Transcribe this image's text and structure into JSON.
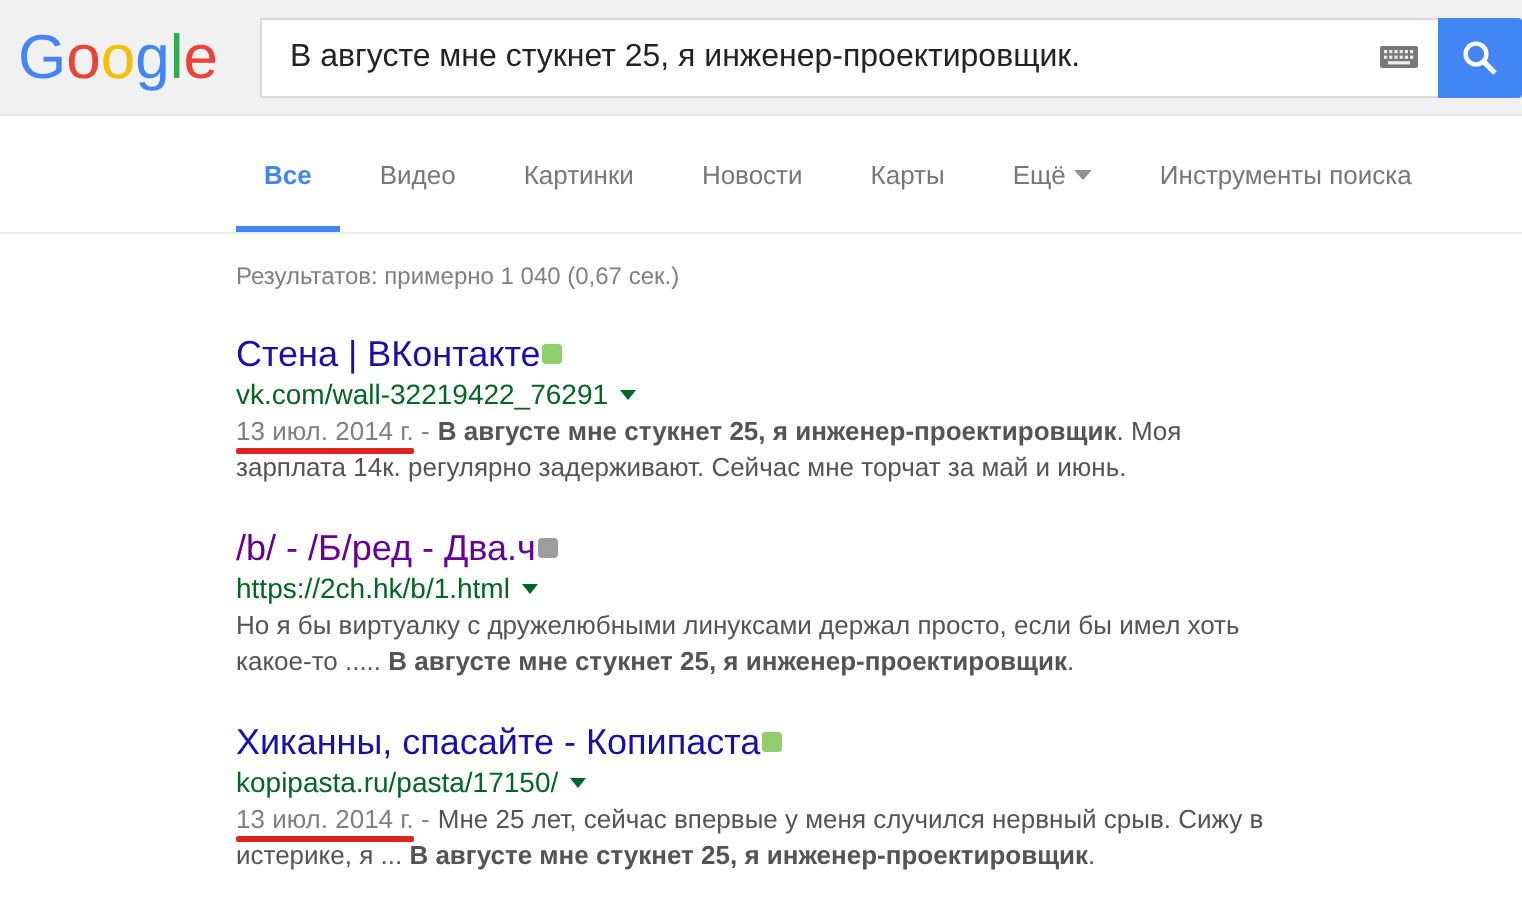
{
  "logo": "Google",
  "search": {
    "value": "В августе мне стукнет 25, я инженер-проектировщик."
  },
  "tabs": [
    {
      "label": "Все",
      "selected": true,
      "kind": "tab"
    },
    {
      "label": "Видео",
      "selected": false,
      "kind": "tab"
    },
    {
      "label": "Картинки",
      "selected": false,
      "kind": "tab"
    },
    {
      "label": "Новости",
      "selected": false,
      "kind": "tab"
    },
    {
      "label": "Карты",
      "selected": false,
      "kind": "tab"
    },
    {
      "label": "Ещё",
      "selected": false,
      "kind": "menu"
    },
    {
      "label": "Инструменты поиска",
      "selected": false,
      "kind": "tool"
    }
  ],
  "result_stats": "Результатов: примерно 1 040 (0,67 сек.)",
  "results": [
    {
      "title": "Стена | ВКонтакте",
      "visited": false,
      "color": "#8fce6b",
      "url": "vk.com/wall-32219422_76291",
      "date": "13 июл. 2014 г. -",
      "underlined": true,
      "snippet": "**В августе мне стукнет 25, я инженер-проектировщик**. Моя зарплата 14к. регулярно задерживают. Сейчас мне торчат за май и июнь."
    },
    {
      "title": "/b/ - /Б/ред - Два.ч",
      "visited": true,
      "color": "#9e9e9e",
      "url": "https://2ch.hk/b/1.html",
      "snippet": "Но я бы виртуалку с дружелюбными линуксами держал просто, если бы имел хоть какое-то ..... **В августе мне стукнет 25, я инженер-проектировщик**."
    },
    {
      "title": "Хиканны, спасайте - Копипаста",
      "visited": false,
      "color": "#8fce6b",
      "url": "kopipasta.ru/pasta/17150/",
      "date": "13 июл. 2014 г. -",
      "underlined": true,
      "snippet": "Мне 25 лет, сейчас впервые у меня случился нервный срыв. Сижу в истерике, я ... **В августе мне стукнет 25, я инженер-проектировщик**."
    }
  ]
}
